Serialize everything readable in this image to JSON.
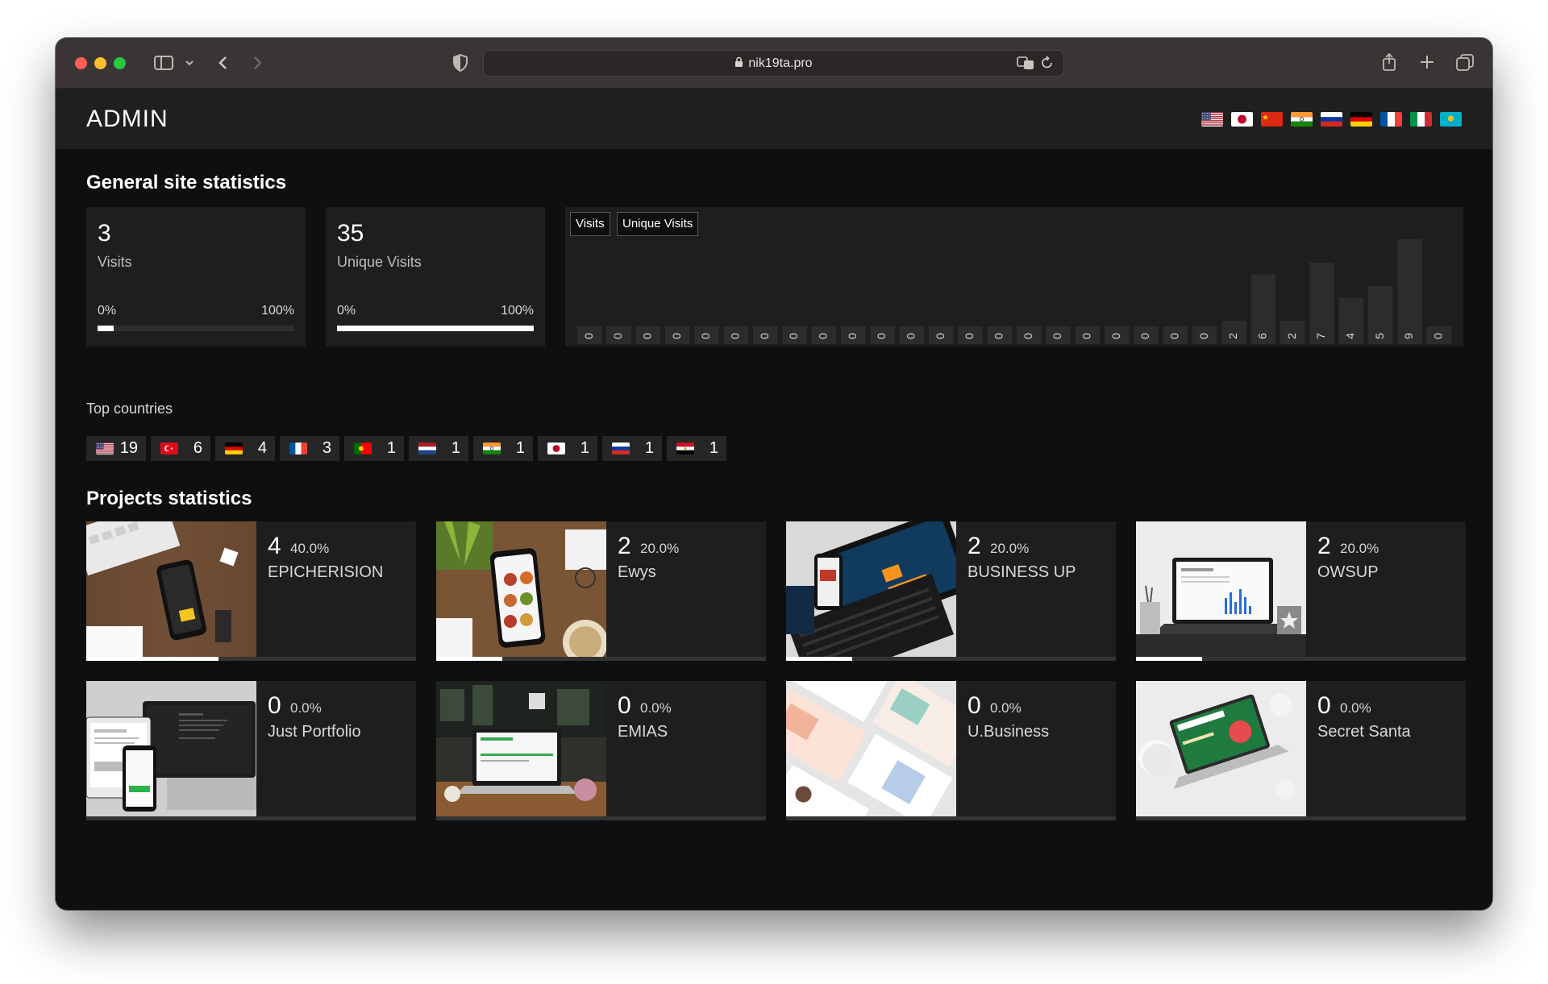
{
  "browser": {
    "url": "nik19ta.pro"
  },
  "header": {
    "title": "ADMIN",
    "languages": [
      "us",
      "jp",
      "cn",
      "in",
      "ru",
      "de",
      "fr",
      "it",
      "kz"
    ]
  },
  "general": {
    "title": "General site statistics",
    "visits": {
      "value": "3",
      "label": "Visits",
      "pmin": "0%",
      "pmax": "100%",
      "fill": 0.08
    },
    "unique": {
      "value": "35",
      "label": "Unique Visits",
      "pmin": "0%",
      "pmax": "100%",
      "fill": 1.0
    }
  },
  "chart_data": {
    "type": "bar",
    "buttons": [
      "Visits",
      "Unique Visits"
    ],
    "values": [
      0,
      0,
      0,
      0,
      0,
      0,
      0,
      0,
      0,
      0,
      0,
      0,
      0,
      0,
      0,
      0,
      0,
      0,
      0,
      0,
      0,
      0,
      2,
      6,
      2,
      7,
      4,
      5,
      9,
      0
    ],
    "ylim": [
      0,
      9
    ],
    "grid": false
  },
  "countries": {
    "label": "Top countries",
    "items": [
      {
        "code": "us",
        "count": "19"
      },
      {
        "code": "tr",
        "count": "6"
      },
      {
        "code": "de",
        "count": "4"
      },
      {
        "code": "fr",
        "count": "3"
      },
      {
        "code": "pt",
        "count": "1"
      },
      {
        "code": "nl",
        "count": "1"
      },
      {
        "code": "in",
        "count": "1"
      },
      {
        "code": "jp",
        "count": "1"
      },
      {
        "code": "ru",
        "count": "1"
      },
      {
        "code": "eg",
        "count": "1"
      }
    ]
  },
  "projects": {
    "title": "Projects statistics",
    "items": [
      {
        "count": "4",
        "pct": "40.0%",
        "name": "EPICHERISION",
        "fill": 0.4
      },
      {
        "count": "2",
        "pct": "20.0%",
        "name": "Ewys",
        "fill": 0.2
      },
      {
        "count": "2",
        "pct": "20.0%",
        "name": "BUSINESS UP",
        "fill": 0.2
      },
      {
        "count": "2",
        "pct": "20.0%",
        "name": "OWSUP",
        "fill": 0.2
      },
      {
        "count": "0",
        "pct": "0.0%",
        "name": "Just Portfolio",
        "fill": 0
      },
      {
        "count": "0",
        "pct": "0.0%",
        "name": "EMIAS",
        "fill": 0
      },
      {
        "count": "0",
        "pct": "0.0%",
        "name": "U.Business",
        "fill": 0
      },
      {
        "count": "0",
        "pct": "0.0%",
        "name": "Secret Santa",
        "fill": 0
      }
    ]
  }
}
